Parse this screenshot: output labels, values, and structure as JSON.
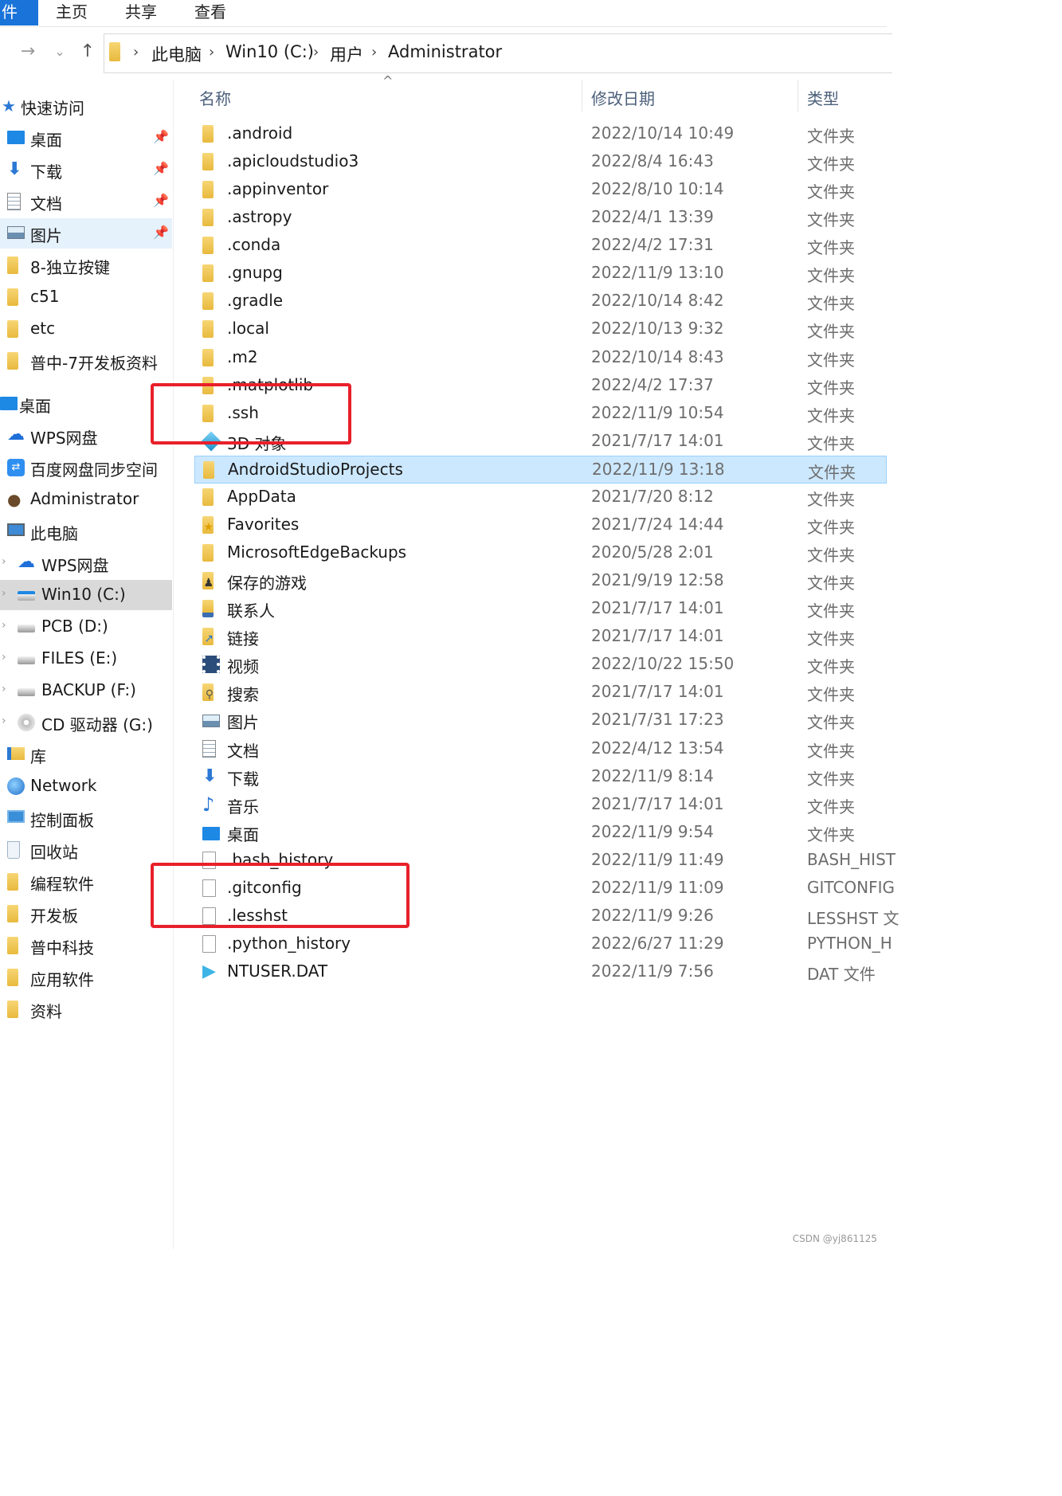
{
  "ribbon": {
    "tabs": [
      "件",
      "主页",
      "共享",
      "查看"
    ]
  },
  "address": {
    "crumbs": [
      "此电脑",
      "Win10 (C:)",
      "用户",
      "Administrator"
    ]
  },
  "sidebar": {
    "items": [
      {
        "label": "快速访问",
        "icon": "star-icon",
        "pinned": false
      },
      {
        "label": "桌面",
        "icon": "desktop-icon",
        "pinned": true
      },
      {
        "label": "下载",
        "icon": "download-icon",
        "pinned": true
      },
      {
        "label": "文档",
        "icon": "document-icon",
        "pinned": true
      },
      {
        "label": "图片",
        "icon": "picture-icon",
        "pinned": true
      },
      {
        "label": "8-独立按键",
        "icon": "folder-icon",
        "pinned": false
      },
      {
        "label": "c51",
        "icon": "folder-icon",
        "pinned": false
      },
      {
        "label": "etc",
        "icon": "folder-icon",
        "pinned": false
      },
      {
        "label": "普中-7开发板资料",
        "icon": "folder-icon",
        "pinned": false
      },
      {
        "label": "桌面",
        "icon": "desktop-icon",
        "pinned": false
      },
      {
        "label": "WPS网盘",
        "icon": "cloud-icon",
        "pinned": false
      },
      {
        "label": "百度网盘同步空间",
        "icon": "baidu-sync-icon",
        "pinned": false
      },
      {
        "label": "Administrator",
        "icon": "user-icon",
        "pinned": false
      },
      {
        "label": "此电脑",
        "icon": "computer-icon",
        "pinned": false
      },
      {
        "label": "WPS网盘",
        "icon": "cloud-icon",
        "pinned": false
      },
      {
        "label": "Win10 (C:)",
        "icon": "system-drive-icon",
        "pinned": false
      },
      {
        "label": "PCB (D:)",
        "icon": "drive-icon",
        "pinned": false
      },
      {
        "label": "FILES (E:)",
        "icon": "drive-icon",
        "pinned": false
      },
      {
        "label": "BACKUP (F:)",
        "icon": "drive-icon",
        "pinned": false
      },
      {
        "label": "CD 驱动器 (G:)",
        "icon": "cd-drive-icon",
        "pinned": false
      },
      {
        "label": "库",
        "icon": "library-icon",
        "pinned": false
      },
      {
        "label": "Network",
        "icon": "network-icon",
        "pinned": false
      },
      {
        "label": "控制面板",
        "icon": "control-panel-icon",
        "pinned": false
      },
      {
        "label": "回收站",
        "icon": "recycle-bin-icon",
        "pinned": false
      },
      {
        "label": "编程软件",
        "icon": "folder-icon",
        "pinned": false
      },
      {
        "label": "开发板",
        "icon": "folder-icon",
        "pinned": false
      },
      {
        "label": "普中科技",
        "icon": "folder-icon",
        "pinned": false
      },
      {
        "label": "应用软件",
        "icon": "folder-icon",
        "pinned": false
      },
      {
        "label": "资料",
        "icon": "folder-icon",
        "pinned": false
      }
    ]
  },
  "columns": {
    "name": "名称",
    "date": "修改日期",
    "type": "类型"
  },
  "files": [
    {
      "name": ".android",
      "date": "2022/10/14 10:49",
      "type": "文件夹",
      "icon": "folder-icon"
    },
    {
      "name": ".apicloudstudio3",
      "date": "2022/8/4 16:43",
      "type": "文件夹",
      "icon": "folder-icon"
    },
    {
      "name": ".appinventor",
      "date": "2022/8/10 10:14",
      "type": "文件夹",
      "icon": "folder-icon"
    },
    {
      "name": ".astropy",
      "date": "2022/4/1 13:39",
      "type": "文件夹",
      "icon": "folder-icon"
    },
    {
      "name": ".conda",
      "date": "2022/4/2 17:31",
      "type": "文件夹",
      "icon": "folder-icon"
    },
    {
      "name": ".gnupg",
      "date": "2022/11/9 13:10",
      "type": "文件夹",
      "icon": "folder-icon"
    },
    {
      "name": ".gradle",
      "date": "2022/10/14 8:42",
      "type": "文件夹",
      "icon": "folder-icon"
    },
    {
      "name": ".local",
      "date": "2022/10/13 9:32",
      "type": "文件夹",
      "icon": "folder-icon"
    },
    {
      "name": ".m2",
      "date": "2022/10/14 8:43",
      "type": "文件夹",
      "icon": "folder-icon"
    },
    {
      "name": ".matplotlib",
      "date": "2022/4/2 17:37",
      "type": "文件夹",
      "icon": "folder-icon"
    },
    {
      "name": ".ssh",
      "date": "2022/11/9 10:54",
      "type": "文件夹",
      "icon": "folder-icon"
    },
    {
      "name": "3D 对象",
      "date": "2021/7/17 14:01",
      "type": "文件夹",
      "icon": "3d-objects-icon"
    },
    {
      "name": "AndroidStudioProjects",
      "date": "2022/11/9 13:18",
      "type": "文件夹",
      "icon": "folder-icon",
      "selected": true
    },
    {
      "name": "AppData",
      "date": "2021/7/20 8:12",
      "type": "文件夹",
      "icon": "folder-icon"
    },
    {
      "name": "Favorites",
      "date": "2021/7/24 14:44",
      "type": "文件夹",
      "icon": "favorites-folder-icon"
    },
    {
      "name": "MicrosoftEdgeBackups",
      "date": "2020/5/28 2:01",
      "type": "文件夹",
      "icon": "folder-icon"
    },
    {
      "name": "保存的游戏",
      "date": "2021/9/19 12:58",
      "type": "文件夹",
      "icon": "saved-games-icon"
    },
    {
      "name": "联系人",
      "date": "2021/7/17 14:01",
      "type": "文件夹",
      "icon": "contacts-icon"
    },
    {
      "name": "链接",
      "date": "2021/7/17 14:01",
      "type": "文件夹",
      "icon": "links-icon"
    },
    {
      "name": "视频",
      "date": "2022/10/22 15:50",
      "type": "文件夹",
      "icon": "video-icon"
    },
    {
      "name": "搜索",
      "date": "2021/7/17 14:01",
      "type": "文件夹",
      "icon": "search-folder-icon"
    },
    {
      "name": "图片",
      "date": "2021/7/31 17:23",
      "type": "文件夹",
      "icon": "picture-icon"
    },
    {
      "name": "文档",
      "date": "2022/4/12 13:54",
      "type": "文件夹",
      "icon": "document-icon"
    },
    {
      "name": "下载",
      "date": "2022/11/9 8:14",
      "type": "文件夹",
      "icon": "download-icon"
    },
    {
      "name": "音乐",
      "date": "2021/7/17 14:01",
      "type": "文件夹",
      "icon": "music-icon"
    },
    {
      "name": "桌面",
      "date": "2022/11/9 9:54",
      "type": "文件夹",
      "icon": "desktop-icon"
    },
    {
      "name": ".bash_history",
      "date": "2022/11/9 11:49",
      "type": "BASH_HIST",
      "icon": "file-icon"
    },
    {
      "name": ".gitconfig",
      "date": "2022/11/9 11:09",
      "type": "GITCONFIG",
      "icon": "file-icon"
    },
    {
      "name": ".lesshst",
      "date": "2022/11/9 9:26",
      "type": "LESSHST 文",
      "icon": "file-icon"
    },
    {
      "name": ".python_history",
      "date": "2022/6/27 11:29",
      "type": "PYTHON_H",
      "icon": "file-icon"
    },
    {
      "name": "NTUSER.DAT",
      "date": "2022/11/9 7:56",
      "type": "DAT 文件",
      "icon": "media-file-icon"
    }
  ],
  "colors": {
    "selection": "#cce8ff",
    "annotation": "#e8202a",
    "accent": "#1a73d9"
  },
  "watermark": "CSDN @yj861125"
}
